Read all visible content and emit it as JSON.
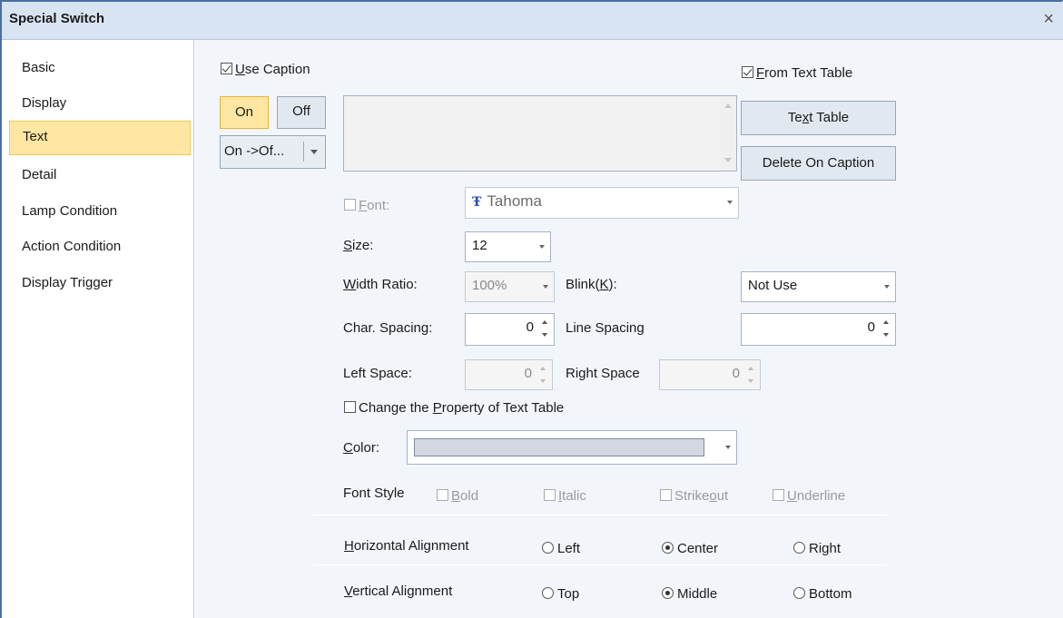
{
  "window": {
    "title": "Special Switch",
    "close_glyph": "×"
  },
  "sidebar": {
    "items": [
      {
        "label": "Basic"
      },
      {
        "label": "Display"
      },
      {
        "label": "Text"
      },
      {
        "label": "Detail"
      },
      {
        "label": "Lamp Condition"
      },
      {
        "label": "Action Condition"
      },
      {
        "label": "Display Trigger"
      }
    ],
    "selected": "Text"
  },
  "caption": {
    "use_caption": {
      "pre": "",
      "key": "U",
      "post": "se Caption",
      "checked": true
    },
    "from_text_table": {
      "pre": "",
      "key": "F",
      "post": "rom Text Table",
      "checked": true
    },
    "on_label": "On",
    "off_label": "Off",
    "state_select": "On ->Of...",
    "text_table": {
      "pre": "Te",
      "key": "x",
      "post": "t Table"
    },
    "delete_on_caption": "Delete On Caption"
  },
  "font": {
    "label_pre": "",
    "label_key": "F",
    "label_post": "ont:",
    "checked": false,
    "value": "Tahoma",
    "icon": "truetype-font-icon"
  },
  "size": {
    "label_key": "S",
    "label_post": "ize:",
    "value": "12"
  },
  "width_ratio": {
    "label_key": "W",
    "label_post": "idth Ratio:",
    "value": "100%"
  },
  "blink": {
    "label_pre": "Blink(",
    "label_key": "K",
    "label_post": "):",
    "value": "Not Use"
  },
  "char_spacing": {
    "label": "Char. Spacing:",
    "value": "0"
  },
  "line_spacing": {
    "label": "Line Spacing",
    "value": "0"
  },
  "left_space": {
    "label": "Left Space:",
    "value": "0"
  },
  "right_space": {
    "label": "Right Space",
    "value": "0"
  },
  "change_property": {
    "pre": "Change the ",
    "key": "P",
    "post": "roperty of Text Table",
    "checked": false
  },
  "color": {
    "label_key": "C",
    "label_post": "olor:",
    "swatch": "#d4d8e0"
  },
  "font_style": {
    "label": "Font Style",
    "options": [
      {
        "key": "B",
        "post": "old"
      },
      {
        "key": "I",
        "post": "talic"
      },
      {
        "pre": "Strike",
        "key": "o",
        "post": "ut"
      },
      {
        "key": "U",
        "post": "nderline"
      }
    ]
  },
  "h_align": {
    "label_key": "H",
    "label_post": "orizontal Alignment",
    "options": [
      "Left",
      "Center",
      "Right"
    ],
    "selected": "Center"
  },
  "v_align": {
    "label_key": "V",
    "label_post": "ertical Alignment",
    "options": [
      "Top",
      "Middle",
      "Bottom"
    ],
    "selected": "Middle"
  },
  "colors": {
    "accent": "#ffe7a3",
    "accent_border": "#f2c84b",
    "titlebar": "#d9e4f2",
    "panel": "#f2f6fb"
  }
}
